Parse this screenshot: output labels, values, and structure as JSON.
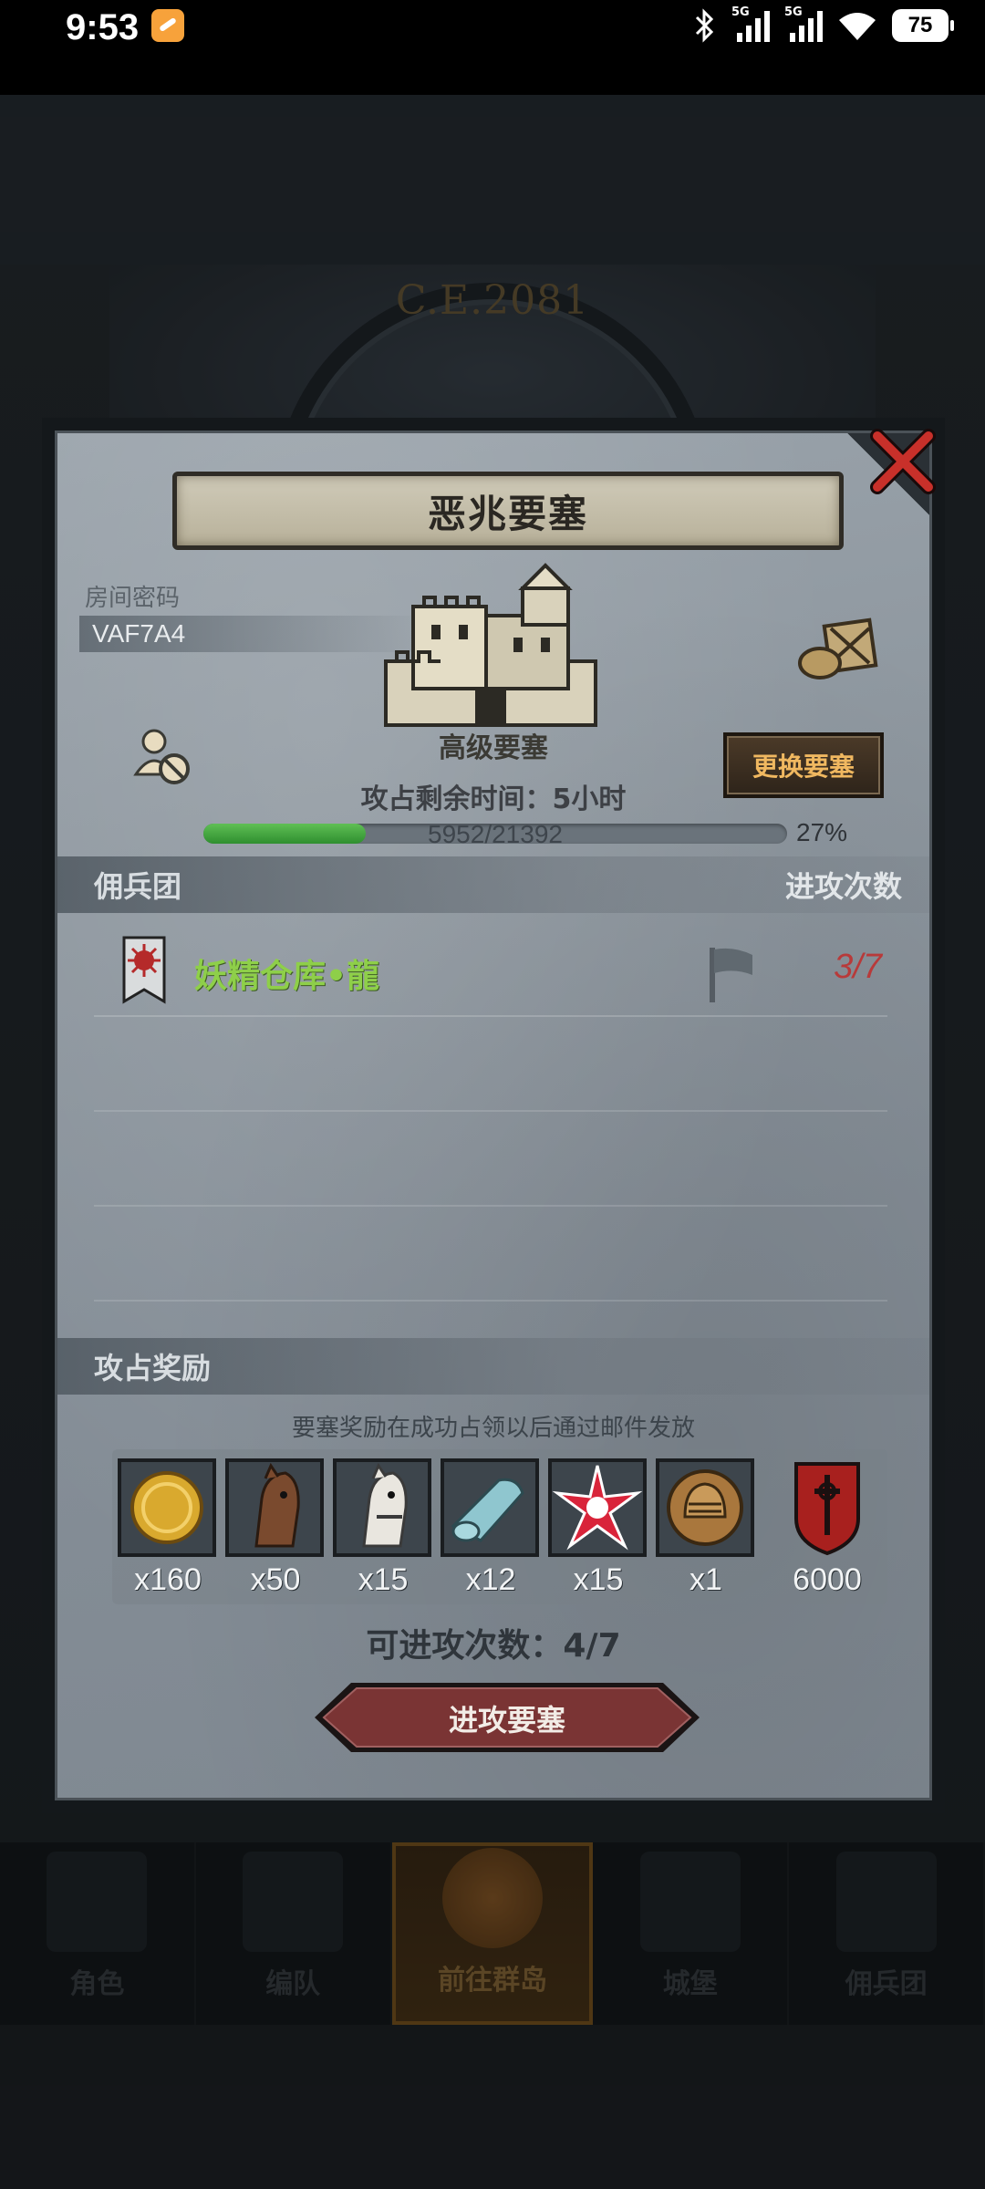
{
  "status_bar": {
    "time": "9:53",
    "network_1": "5G",
    "network_2": "5G",
    "battery": "75",
    "icons": [
      "app-notification-icon",
      "bluetooth-icon",
      "signal-icon",
      "signal-icon",
      "wifi-icon",
      "battery-icon"
    ]
  },
  "background": {
    "year": "C.E.2081",
    "nav": [
      {
        "label": "角色",
        "active": false
      },
      {
        "label": "编队",
        "active": false
      },
      {
        "label": "前往群岛",
        "active": true
      },
      {
        "label": "城堡",
        "active": false
      },
      {
        "label": "佣兵团",
        "active": false
      }
    ]
  },
  "dialog": {
    "title": "恶兆要塞",
    "room_label": "房间密码",
    "room_code": "VAF7A4",
    "fortress_name": "高级要塞",
    "change_button": "更换要塞",
    "time_left": "攻占剩余时间：5小时",
    "progress": {
      "current": 5952,
      "total": 21392,
      "text": "5952/21392",
      "percent": "27%"
    },
    "mercenary_header": "佣兵团",
    "attack_count_header": "进攻次数",
    "mercenaries": [
      {
        "name": "妖精仓库•龍",
        "attacks": "3/7"
      }
    ],
    "reward_header": "攻占奖励",
    "reward_note": "要塞奖励在成功占领以后通过邮件发放",
    "rewards": [
      {
        "icon": "gold-coin-icon",
        "qty": "x160"
      },
      {
        "icon": "brown-horse-icon",
        "qty": "x50"
      },
      {
        "icon": "white-horse-icon",
        "qty": "x15"
      },
      {
        "icon": "cloth-roll-icon",
        "qty": "x12"
      },
      {
        "icon": "red-star-icon",
        "qty": "x15"
      },
      {
        "icon": "knight-helmet-icon",
        "qty": "x1"
      },
      {
        "icon": "guild-shield-icon",
        "qty": "6000"
      }
    ],
    "attacks_left": "可进攻次数：4/7",
    "attack_button": "进攻要塞"
  },
  "colors": {
    "accent_green": "#8ecf49",
    "attack_red": "#b83a3a",
    "button_gold": "#f0b860",
    "attack_button": "#7a3434"
  }
}
